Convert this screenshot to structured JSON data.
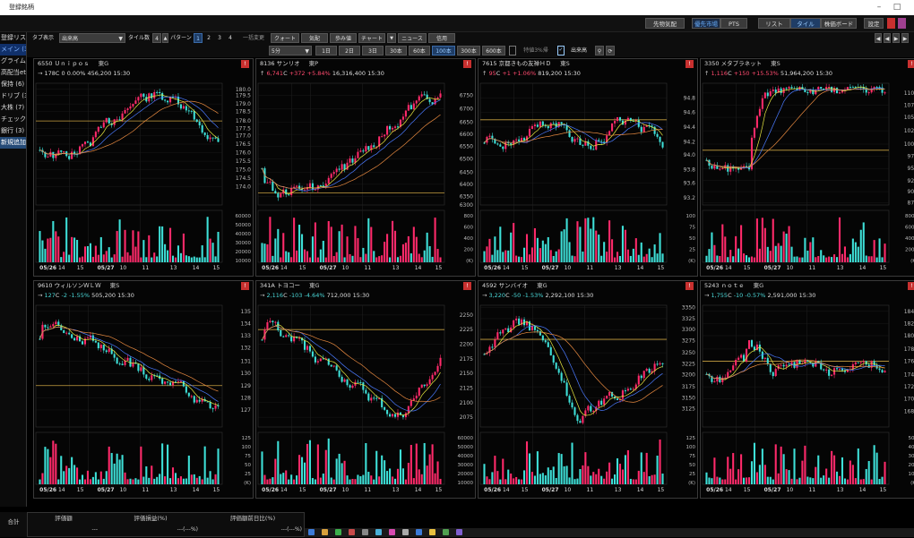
{
  "app": {
    "title": "登録銘柄"
  },
  "toolbar1": {
    "buttons": [
      "先物気配",
      "優先市場",
      "PTS",
      "リスト",
      "タイル",
      "株価ボード",
      "設定"
    ]
  },
  "sidebar": {
    "items": [
      "登録リスト",
      "メイン (32)",
      "グライム (6)",
      "高配当etf",
      "保持 (6)",
      "ドリブ (3)",
      "大株 (7)",
      "チェック用 (",
      "銀行 (3)",
      "新規追加"
    ],
    "active": 1
  },
  "toolbar2": {
    "tab_label": "タブ表示",
    "tab_value": "出来高",
    "tile_label": "タイル数",
    "tile_value": "4",
    "pattern_label": "パターン",
    "patterns": [
      "1",
      "2",
      "3",
      "4"
    ],
    "pattern_selected": 0,
    "bulk_label": "一括変更",
    "tools": [
      "クォート",
      "気配",
      "歩み値",
      "チャート",
      "ニュース",
      "信用"
    ]
  },
  "toolbar3": {
    "interval": "5分",
    "ranges": [
      "1日",
      "2日",
      "3日",
      "30本",
      "60本",
      "100本",
      "300本",
      "600本"
    ],
    "range_selected": 5,
    "range_label": "特値3%帰",
    "volume_label": "出来高"
  },
  "footer": {
    "total": "合計",
    "cols": [
      "評価額",
      "評価損益(%)",
      "評価額前日比(%)"
    ],
    "vals": [
      "---",
      "---(---%)",
      "---(---%)"
    ]
  },
  "panels": [
    {
      "code": "6550",
      "name": "Ｕｎｉｐｏｓ",
      "market": "東G",
      "price": "178",
      "flag": "C",
      "chg": "0",
      "pct": "0.00%",
      "vol": "456,200",
      "time": "15:30",
      "dir": "flat",
      "xt": [
        "05/26",
        "14",
        "15",
        "05/27",
        "10",
        "11",
        "13",
        "14",
        "15"
      ],
      "y": [
        {
          "v": "180.0",
          "f": 0.05
        },
        {
          "v": "179.5",
          "f": 0.1
        },
        {
          "v": "179.0",
          "f": 0.17
        },
        {
          "v": "178.5",
          "f": 0.23
        },
        {
          "v": "178.0",
          "f": 0.31
        },
        {
          "v": "177.5",
          "f": 0.37
        },
        {
          "v": "177.0",
          "f": 0.43
        },
        {
          "v": "176.5",
          "f": 0.5
        },
        {
          "v": "176.0",
          "f": 0.57
        },
        {
          "v": "175.5",
          "f": 0.64
        },
        {
          "v": "175.0",
          "f": 0.71
        },
        {
          "v": "174.5",
          "f": 0.78
        },
        {
          "v": "174.0",
          "f": 0.85
        }
      ],
      "vy": [
        "60000",
        "50000",
        "40000",
        "30000",
        "20000",
        "10000"
      ],
      "trend": "flat",
      "hline": 0.31
    },
    {
      "code": "8136",
      "name": "サンリオ",
      "market": "東P",
      "price": "6,741",
      "flag": "C",
      "chg": "+372",
      "pct": "+5.84%",
      "vol": "16,316,400",
      "time": "15:30",
      "dir": "up",
      "xt": [
        "05/26",
        "14",
        "15",
        "05/27",
        "10",
        "11",
        "13",
        "14",
        "15"
      ],
      "y": [
        {
          "v": "6750",
          "f": 0.1
        },
        {
          "v": "6700",
          "f": 0.21
        },
        {
          "v": "6650",
          "f": 0.32
        },
        {
          "v": "6600",
          "f": 0.42
        },
        {
          "v": "6550",
          "f": 0.52
        },
        {
          "v": "6500",
          "f": 0.62
        },
        {
          "v": "6450",
          "f": 0.73
        },
        {
          "v": "6400",
          "f": 0.83
        },
        {
          "v": "6350",
          "f": 0.93
        },
        {
          "v": "6300",
          "f": 1.0
        }
      ],
      "vy": [
        "800",
        "600",
        "400",
        "200",
        "(K)"
      ],
      "trend": "up",
      "hline": 0.9
    },
    {
      "code": "7615",
      "name": "京都きもの友禅ＨＤ",
      "market": "東S",
      "price": "95",
      "flag": "C",
      "chg": "+1",
      "pct": "+1.06%",
      "vol": "819,200",
      "time": "15:30",
      "dir": "up",
      "xt": [
        "05/26",
        "14",
        "15",
        "05/27",
        "10",
        "11",
        "13",
        "14",
        "15"
      ],
      "y": [
        {
          "v": "94.8",
          "f": 0.12
        },
        {
          "v": "94.6",
          "f": 0.24
        },
        {
          "v": "94.4",
          "f": 0.36
        },
        {
          "v": "94.2",
          "f": 0.48
        },
        {
          "v": "94.0",
          "f": 0.59
        },
        {
          "v": "93.8",
          "f": 0.71
        },
        {
          "v": "93.6",
          "f": 0.82
        },
        {
          "v": "93.2",
          "f": 0.94
        }
      ],
      "vy": [
        "100",
        "75",
        "50",
        "25",
        "(K)"
      ],
      "trend": "mixed",
      "hline": 0.3
    },
    {
      "code": "3350",
      "name": "メタプラネット",
      "market": "東S",
      "price": "1,116",
      "flag": "C",
      "chg": "+150",
      "pct": "+15.53%",
      "vol": "51,964,200",
      "time": "15:30",
      "dir": "up",
      "xt": [
        "05/26",
        "14",
        "15",
        "05/27",
        "10",
        "11",
        "13",
        "14",
        "15"
      ],
      "y": [
        {
          "v": "1100",
          "f": 0.08
        },
        {
          "v": "1075",
          "f": 0.18
        },
        {
          "v": "1050",
          "f": 0.28
        },
        {
          "v": "1025",
          "f": 0.39
        },
        {
          "v": "1000",
          "f": 0.5
        },
        {
          "v": "975",
          "f": 0.6
        },
        {
          "v": "950",
          "f": 0.7
        },
        {
          "v": "925",
          "f": 0.8
        },
        {
          "v": "900",
          "f": 0.89
        },
        {
          "v": "875",
          "f": 0.98
        }
      ],
      "vy": [
        "8000",
        "6000",
        "4000",
        "2000",
        "(K)"
      ],
      "trend": "jump",
      "hline": 0.55
    },
    {
      "code": "9610",
      "name": "ウィルソンＷＬＷ",
      "market": "東S",
      "price": "127",
      "flag": "C",
      "chg": "-2",
      "pct": "-1.55%",
      "vol": "505,200",
      "time": "15:30",
      "dir": "dn",
      "xt": [
        "05/26",
        "14",
        "15",
        "05/27",
        "10",
        "11",
        "13",
        "14",
        "15"
      ],
      "y": [
        {
          "v": "135",
          "f": 0.05
        },
        {
          "v": "134",
          "f": 0.15
        },
        {
          "v": "133",
          "f": 0.25
        },
        {
          "v": "132",
          "f": 0.35
        },
        {
          "v": "131",
          "f": 0.46
        },
        {
          "v": "130",
          "f": 0.56
        },
        {
          "v": "129",
          "f": 0.66
        },
        {
          "v": "128",
          "f": 0.76
        },
        {
          "v": "127",
          "f": 0.86
        }
      ],
      "vy": [
        "125",
        "100",
        "75",
        "50",
        "25",
        "(K)"
      ],
      "trend": "down",
      "hline": 0.66
    },
    {
      "code": "341A",
      "name": "トヨコー",
      "market": "東G",
      "price": "2,116",
      "flag": "C",
      "chg": "-103",
      "pct": "-4.64%",
      "vol": "712,000",
      "time": "15:30",
      "dir": "dn",
      "xt": [
        "05/26",
        "14",
        "15",
        "05/27",
        "10",
        "11",
        "13",
        "14",
        "15"
      ],
      "y": [
        {
          "v": "2250",
          "f": 0.08
        },
        {
          "v": "2225",
          "f": 0.2
        },
        {
          "v": "2200",
          "f": 0.32
        },
        {
          "v": "2175",
          "f": 0.44
        },
        {
          "v": "2150",
          "f": 0.56
        },
        {
          "v": "2125",
          "f": 0.68
        },
        {
          "v": "2100",
          "f": 0.8
        },
        {
          "v": "2075",
          "f": 0.92
        }
      ],
      "vy": [
        "60000",
        "50000",
        "40000",
        "30000",
        "20000",
        "10000"
      ],
      "trend": "downrec",
      "hline": 0.2
    },
    {
      "code": "4592",
      "name": "サンバイオ",
      "market": "東G",
      "price": "3,220",
      "flag": "C",
      "chg": "-50",
      "pct": "-1.53%",
      "vol": "2,292,100",
      "time": "15:30",
      "dir": "dn",
      "xt": [
        "05/26",
        "14",
        "15",
        "05/27",
        "10",
        "11",
        "13",
        "14",
        "15"
      ],
      "y": [
        {
          "v": "3350",
          "f": 0.02
        },
        {
          "v": "3325",
          "f": 0.11
        },
        {
          "v": "3300",
          "f": 0.2
        },
        {
          "v": "3275",
          "f": 0.29
        },
        {
          "v": "3250",
          "f": 0.39
        },
        {
          "v": "3225",
          "f": 0.48
        },
        {
          "v": "3200",
          "f": 0.57
        },
        {
          "v": "3175",
          "f": 0.67
        },
        {
          "v": "3150",
          "f": 0.76
        },
        {
          "v": "3125",
          "f": 0.85
        }
      ],
      "vy": [
        "125",
        "100",
        "75",
        "50",
        "25",
        "(K)"
      ],
      "trend": "vdip",
      "hline": 0.28
    },
    {
      "code": "5243",
      "name": "ｎｏｔｅ",
      "market": "東G",
      "price": "1,755",
      "flag": "C",
      "chg": "-10",
      "pct": "-0.57%",
      "vol": "2,591,000",
      "time": "15:30",
      "dir": "dn",
      "xt": [
        "05/26",
        "14",
        "15",
        "05/27",
        "10",
        "11",
        "13",
        "14",
        "15"
      ],
      "y": [
        {
          "v": "1840",
          "f": 0.05
        },
        {
          "v": "1820",
          "f": 0.15
        },
        {
          "v": "1800",
          "f": 0.25
        },
        {
          "v": "1780",
          "f": 0.36
        },
        {
          "v": "1760",
          "f": 0.46
        },
        {
          "v": "1740",
          "f": 0.57
        },
        {
          "v": "1720",
          "f": 0.67
        },
        {
          "v": "1700",
          "f": 0.77
        },
        {
          "v": "1680",
          "f": 0.87
        }
      ],
      "vy": [
        "500",
        "400",
        "300",
        "200",
        "100",
        "(K)"
      ],
      "trend": "spike",
      "hline": 0.46
    }
  ]
}
